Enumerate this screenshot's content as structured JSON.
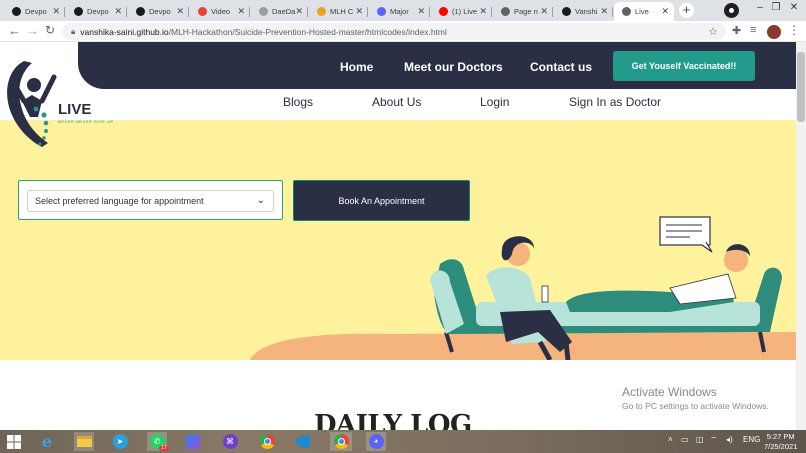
{
  "browser": {
    "tabs": [
      {
        "title": "Devpo",
        "icon": "devpost-icon",
        "color": "#1a1a1a"
      },
      {
        "title": "Devpo",
        "icon": "devpost-icon",
        "color": "#1a1a1a"
      },
      {
        "title": "Devpo",
        "icon": "devpost-icon",
        "color": "#1a1a1a"
      },
      {
        "title": "Video",
        "icon": "photos-icon",
        "color": "#ea4335"
      },
      {
        "title": "DaeDa",
        "icon": "globe-icon",
        "color": "#9e9e9e"
      },
      {
        "title": "MLH C",
        "icon": "mlh-icon",
        "color": "#e8a21f"
      },
      {
        "title": "Major",
        "icon": "discord-icon",
        "color": "#5865f2"
      },
      {
        "title": "(1) Live",
        "icon": "youtube-icon",
        "color": "#ff0000"
      },
      {
        "title": "Page n",
        "icon": "globe-icon",
        "color": "#5f6368"
      },
      {
        "title": "Vanshi",
        "icon": "github-icon",
        "color": "#1a1a1a"
      },
      {
        "title": "Live",
        "icon": "globe-icon",
        "color": "#5f6368",
        "active": true
      }
    ],
    "url_host": "vanshika-saini.github.io",
    "url_path": "/MLH-Hackathon/Suicide-Prevention-Hosted-master/htmlcodes/index.html"
  },
  "page": {
    "logo_text": "LIVE",
    "logo_tagline": "NEVER NEVER GIVE UP",
    "nav": {
      "home": "Home",
      "doctors": "Meet our Doctors",
      "contact": "Contact us",
      "vaccinated": "Get Youself Vaccinated!!"
    },
    "subnav": {
      "blogs": "Blogs",
      "about": "About Us",
      "login": "Login",
      "doctor_signin": "Sign In as Doctor"
    },
    "language_select": "Select preferred language for appointment",
    "book_button": "Book An Appointment",
    "section_heading": "DAILY LOG",
    "activate_title": "Activate Windows",
    "activate_sub": "Go to PC settings to activate Windows.",
    "colors": {
      "hero_bg": "#fef29c",
      "nav_dark": "#2b2f45",
      "accent": "#229b8d"
    }
  },
  "taskbar": {
    "lang": "ENG",
    "time": "5:27 PM",
    "date": "7/25/2021",
    "whatsapp_badge": "17",
    "apps": [
      "windows-start-icon",
      "ie-icon",
      "file-explorer-icon",
      "telegram-icon",
      "whatsapp-icon",
      "photos-app-icon",
      "github-desktop-icon",
      "chrome-icon",
      "vscode-icon",
      "chrome-profile-icon",
      "discord-icon"
    ]
  }
}
